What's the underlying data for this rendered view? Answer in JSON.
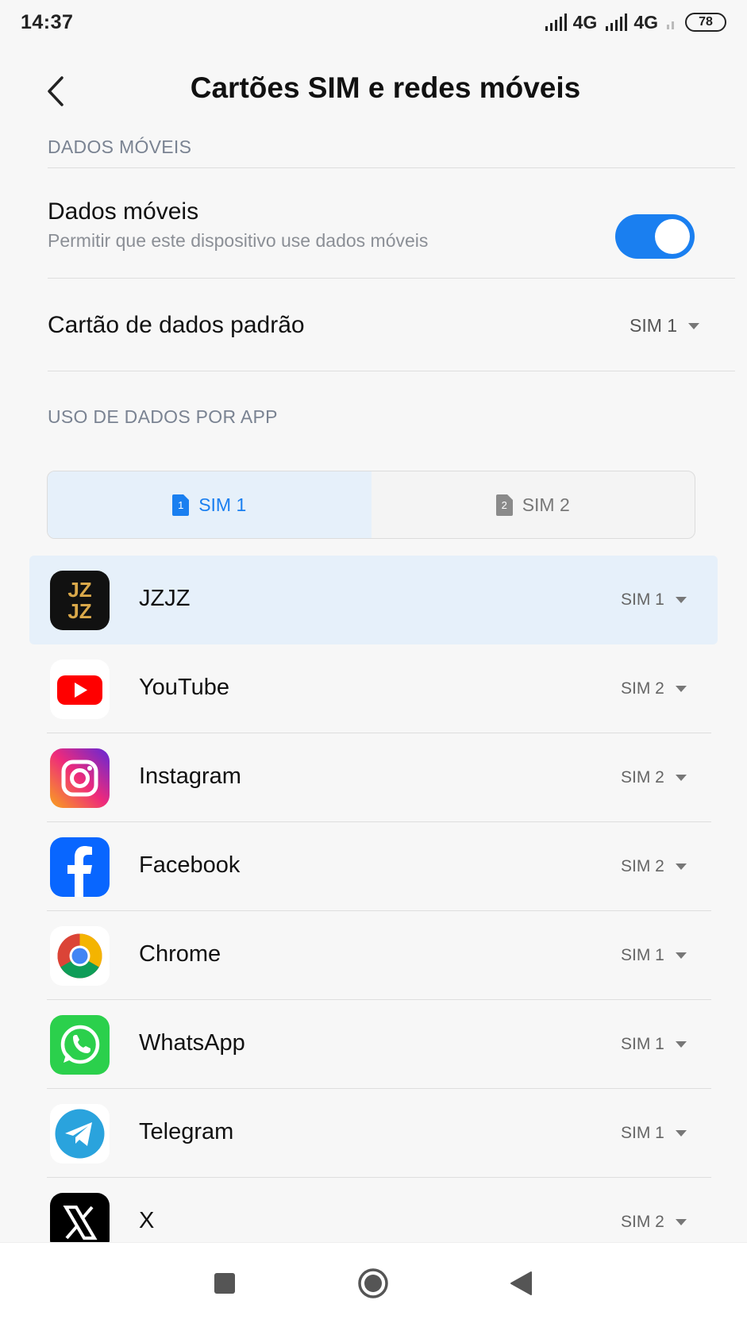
{
  "status_bar": {
    "time": "14:37",
    "network_1": "4G",
    "network_2": "4G",
    "battery": "78"
  },
  "header": {
    "title": "Cartões SIM e redes móveis"
  },
  "section_mobile_data": {
    "label": "DADOS MÓVEIS",
    "mobile_data": {
      "title": "Dados móveis",
      "subtitle": "Permitir que este dispositivo use dados móveis",
      "enabled": true
    },
    "default_data_card": {
      "title": "Cartão de dados padrão",
      "value": "SIM 1"
    }
  },
  "section_app_usage": {
    "label": "USO DE DADOS POR APP",
    "tabs": [
      {
        "label": "SIM 1",
        "number": "1",
        "active": true
      },
      {
        "label": "SIM 2",
        "number": "2",
        "active": false
      }
    ],
    "apps": [
      {
        "name": "JZJZ",
        "sim": "SIM 1",
        "icon": "jzjz-app-icon",
        "icon_text_1": "JZ",
        "icon_text_2": "JZ"
      },
      {
        "name": "YouTube",
        "sim": "SIM 2",
        "icon": "youtube-icon"
      },
      {
        "name": "Instagram",
        "sim": "SIM 2",
        "icon": "instagram-icon"
      },
      {
        "name": "Facebook",
        "sim": "SIM 2",
        "icon": "facebook-icon"
      },
      {
        "name": "Chrome",
        "sim": "SIM 1",
        "icon": "chrome-icon"
      },
      {
        "name": "WhatsApp",
        "sim": "SIM 1",
        "icon": "whatsapp-icon"
      },
      {
        "name": "Telegram",
        "sim": "SIM 1",
        "icon": "telegram-icon"
      },
      {
        "name": "X",
        "sim": "SIM 2",
        "icon": "x-icon"
      }
    ]
  },
  "colors": {
    "accent": "#1a7ff0",
    "highlight_bg": "#e6f0fa",
    "background": "#f7f7f7"
  },
  "nav_bar": {
    "buttons": [
      "recents-icon",
      "home-icon",
      "back-nav-icon"
    ]
  }
}
